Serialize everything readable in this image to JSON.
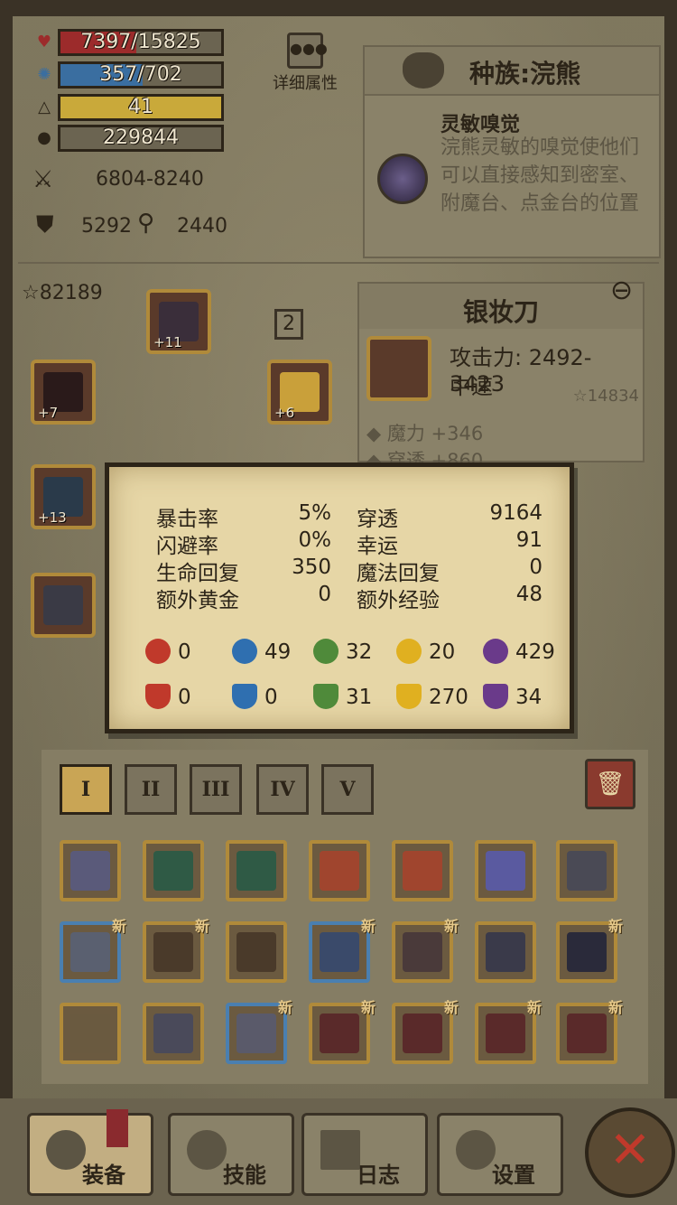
{
  "stats": {
    "hp": "7397/15825",
    "mp": "357/702",
    "level": "41",
    "gold": "229844",
    "attack": "6804-8240",
    "defense": "5292",
    "magic_power": "2440",
    "star_score": "82189"
  },
  "detail_button": {
    "label": "详细属性",
    "icon": "dots-icon"
  },
  "race": {
    "title": "种族:浣熊",
    "skill_name": "灵敏嗅觉",
    "skill_desc": "浣熊灵敏的嗅觉使他们可以直接感知到密室、附魔台、点金台的位置"
  },
  "equipment": {
    "slots": [
      {
        "name": "helmet",
        "plus": "+11"
      },
      {
        "name": "armor",
        "plus": "+7"
      },
      {
        "name": "weapon",
        "plus": "+13"
      },
      {
        "name": "gauntlet",
        "plus": ""
      },
      {
        "name": "money-bag",
        "plus": "+6"
      }
    ],
    "count": "2"
  },
  "weapon": {
    "name": "银妆刀",
    "attack": "攻击力: 2492-3423",
    "speed": "中速",
    "stars": "14834",
    "bonus1": "魔力 +346",
    "bonus2": "穿透 +860"
  },
  "tooltip": {
    "rows": [
      {
        "l1": "暴击率",
        "v1": "5%",
        "l2": "穿透",
        "v2": "9164"
      },
      {
        "l1": "闪避率",
        "v1": "0%",
        "l2": "幸运",
        "v2": "91"
      },
      {
        "l1": "生命回复",
        "v1": "350",
        "l2": "魔法回复",
        "v2": "0"
      },
      {
        "l1": "额外黄金",
        "v1": "0",
        "l2": "额外经验",
        "v2": "48"
      }
    ],
    "attack_elements": [
      "0",
      "49",
      "32",
      "20",
      "429"
    ],
    "resist_elements": [
      "0",
      "0",
      "31",
      "270",
      "34"
    ],
    "element_colors": [
      "#c0392b",
      "#2f6fb0",
      "#4f8a3a",
      "#e0b020",
      "#6a3a8a"
    ]
  },
  "inventory": {
    "tabs": [
      "I",
      "II",
      "III",
      "IV",
      "V"
    ],
    "new_label": "新",
    "items": [
      {
        "name": "bone-sword",
        "color": "#5a5a7a",
        "blue": false,
        "isNew": false
      },
      {
        "name": "green-scimitar",
        "color": "#2f5a45",
        "blue": false,
        "isNew": false
      },
      {
        "name": "green-scimitar",
        "color": "#2f5a45",
        "blue": false,
        "isNew": false
      },
      {
        "name": "flame-sword",
        "color": "#a0452e",
        "blue": false,
        "isNew": false
      },
      {
        "name": "flame-sword",
        "color": "#a0452e",
        "blue": false,
        "isNew": false
      },
      {
        "name": "crystal-sword",
        "color": "#5a5aa0",
        "blue": false,
        "isNew": false
      },
      {
        "name": "steel-helmet",
        "color": "#4a4a55",
        "blue": false,
        "isNew": false
      },
      {
        "name": "knight-helmet",
        "color": "#5a6070",
        "blue": true,
        "isNew": true
      },
      {
        "name": "hood",
        "color": "#4a3a2a",
        "blue": false,
        "isNew": true
      },
      {
        "name": "hood",
        "color": "#4a3a2a",
        "blue": false,
        "isNew": false
      },
      {
        "name": "horned-helmet",
        "color": "#3a4a6a",
        "blue": true,
        "isNew": true
      },
      {
        "name": "chest-armor",
        "color": "#4a3a3a",
        "blue": false,
        "isNew": true
      },
      {
        "name": "plate-armor",
        "color": "#3a3a4a",
        "blue": false,
        "isNew": false
      },
      {
        "name": "dark-armor",
        "color": "#2a2a3a",
        "blue": false,
        "isNew": true
      },
      {
        "name": "leg-armor",
        "color": "#6a5a40",
        "blue": false,
        "isNew": false
      },
      {
        "name": "steel-greaves",
        "color": "#4a4a5a",
        "blue": false,
        "isNew": false
      },
      {
        "name": "silver-armor",
        "color": "#5a5a6a",
        "blue": true,
        "isNew": true
      },
      {
        "name": "red-boots",
        "color": "#5a2a2a",
        "blue": false,
        "isNew": true
      },
      {
        "name": "red-boots",
        "color": "#5a2a2a",
        "blue": false,
        "isNew": true
      },
      {
        "name": "red-boots",
        "color": "#5a2a2a",
        "blue": false,
        "isNew": true
      },
      {
        "name": "red-boots",
        "color": "#5a2a2a",
        "blue": false,
        "isNew": true
      }
    ]
  },
  "nav": {
    "equip": "装备",
    "skill": "技能",
    "log": "日志",
    "settings": "设置",
    "close": "✕"
  },
  "colors": {
    "hp_bar": "#9c2b2b",
    "mp_bar": "#3a6ea0",
    "level_bar": "#c9a93a",
    "gold_bar": "#6b6451"
  }
}
